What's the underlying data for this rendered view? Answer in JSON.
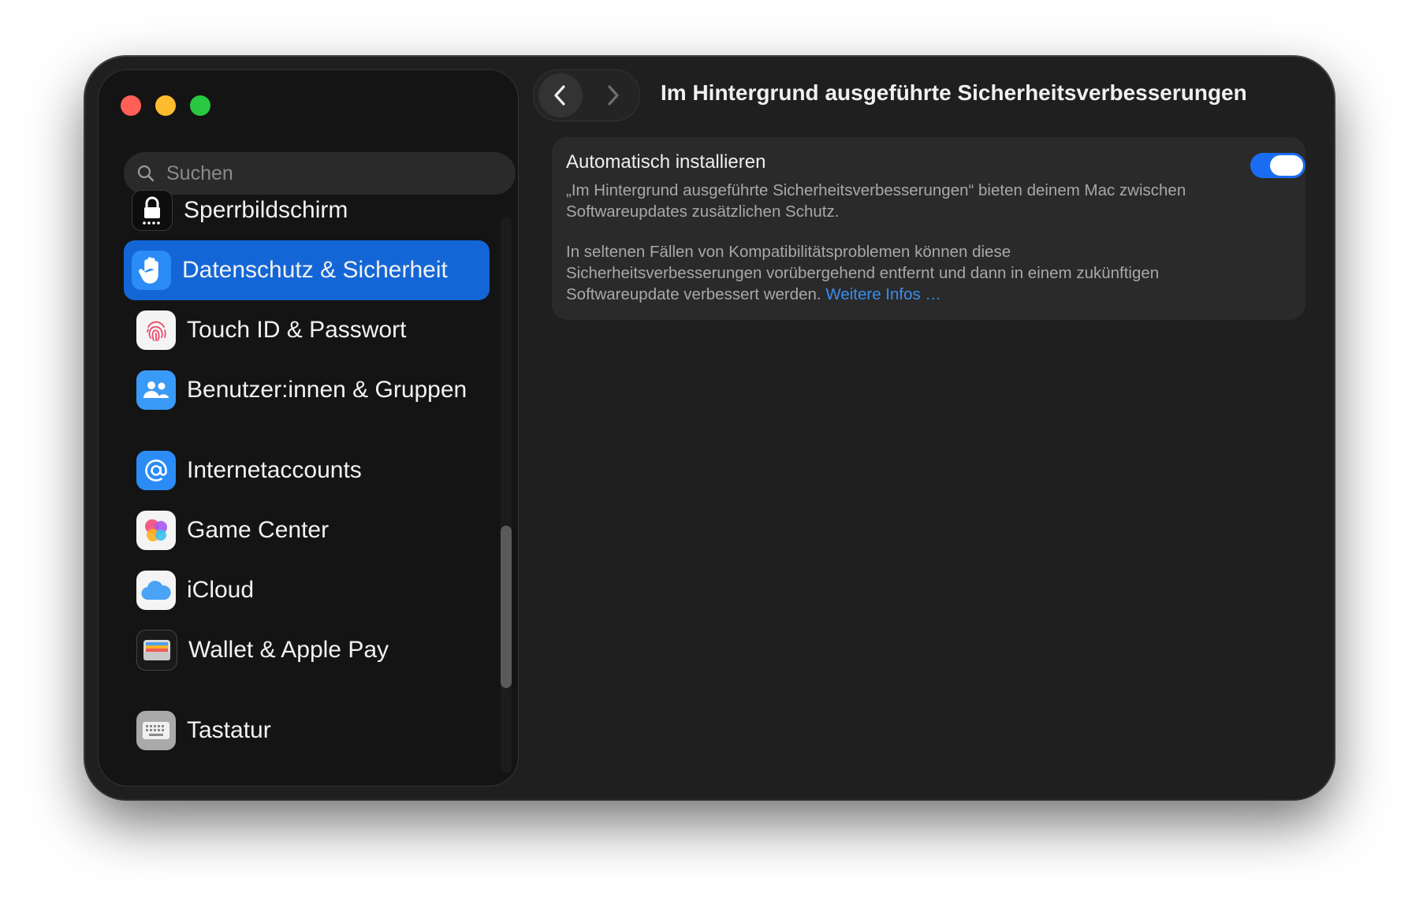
{
  "window": {
    "title": "Im Hintergrund ausgeführte Sicherheitsverbesserungen"
  },
  "search": {
    "placeholder": "Suchen"
  },
  "sidebar": {
    "items": [
      {
        "label": "Sperrbildschirm",
        "icon": "lock-icon"
      },
      {
        "label": "Datenschutz & Sicherheit",
        "icon": "hand-icon",
        "selected": true
      },
      {
        "label": "Touch ID & Passwort",
        "icon": "fingerprint-icon"
      },
      {
        "label": "Benutzer:innen & Gruppen",
        "icon": "users-icon"
      },
      {
        "label": "Internetaccounts",
        "icon": "at-icon"
      },
      {
        "label": "Game Center",
        "icon": "game-center-icon"
      },
      {
        "label": "iCloud",
        "icon": "cloud-icon"
      },
      {
        "label": "Wallet & Apple Pay",
        "icon": "wallet-icon"
      },
      {
        "label": "Tastatur",
        "icon": "keyboard-icon"
      }
    ]
  },
  "setting": {
    "title": "Automatisch installieren",
    "enabled": true,
    "description_1": "„Im Hintergrund ausgeführte Sicherheitsverbesserungen“ bieten deinem Mac zwischen Softwareupdates zusätzlichen Schutz.",
    "description_2": "In seltenen Fällen von Kompatibilitätsproblemen können diese Sicherheitsverbesserungen vorübergehend entfernt und dann in einem zukünftigen Softwareupdate verbessert werden.",
    "link_label": "Weitere Infos …"
  },
  "colors": {
    "accent": "#1466d6",
    "toggle_on": "#1a6df2",
    "link": "#3b8ef0"
  }
}
